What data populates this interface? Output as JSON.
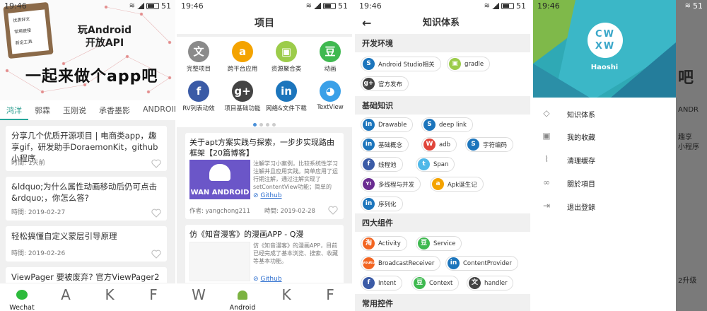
{
  "status": {
    "time": "19:46",
    "battery": "51"
  },
  "phone1": {
    "banner": {
      "clipboard_items": [
        "优质好文",
        "常用链接",
        "新定工具"
      ],
      "title_line1": "玩Android",
      "title_line2": "开放API",
      "slogan": "一起来做个app吧"
    },
    "tabs": [
      "鸿洋",
      "郭霖",
      "玉刚说",
      "承香墨影",
      "ANDROID"
    ],
    "articles": [
      {
        "title": "分享几个优质开源项目 | 电商类app，趣享gif，研发助手DoraemonKit，github小程序",
        "meta": "时間: 1天前"
      },
      {
        "title": "&ldquo;为什么属性动画移动后仍可点击&rdquo;，你怎么答?",
        "meta": "時間: 2019-02-27"
      },
      {
        "title": "轻松搞懂自定义蒙层引导原理",
        "meta": "時間: 2019-02-26"
      },
      {
        "title": "ViewPager 要被废弃? 官方ViewPager2升级",
        "meta": ""
      }
    ],
    "bottom_nav": [
      {
        "icon": "wechat-icon",
        "label": "Wechat"
      },
      {
        "icon": "A",
        "label": ""
      },
      {
        "icon": "K",
        "label": ""
      },
      {
        "icon": "F",
        "label": ""
      }
    ]
  },
  "phone2": {
    "title": "项目",
    "grid": [
      {
        "label": "完整项目",
        "glyph": "文",
        "color": "#8a8a8a"
      },
      {
        "label": "跨平台应用",
        "glyph": "a",
        "color": "#f4a300"
      },
      {
        "label": "资源聚合类",
        "glyph": "▣",
        "color": "#9ccc4a"
      },
      {
        "label": "动画",
        "glyph": "豆",
        "color": "#3fb950"
      },
      {
        "label": "RV列表动效",
        "glyph": "f",
        "color": "#3b5ba6"
      },
      {
        "label": "项目基础功能",
        "glyph": "g+",
        "color": "#444444"
      },
      {
        "label": "网络&文件下载",
        "glyph": "in",
        "color": "#1c75bc"
      },
      {
        "label": "TextView",
        "glyph": "◕",
        "color": "#3aa0e8"
      }
    ],
    "cards": [
      {
        "title": "关于apt方案实践与探索，一步步实现路由框架【20篇博客】",
        "thumb_text": "WAN ANDROID",
        "desc": "注解学习小案例，比较系统性学习注解并且应用实践。简单应用了运行期注解，通过注解实现了setContentView功能；简单的",
        "github": "Github",
        "author": "作者: yangchong211",
        "time": "時間: 2019-02-28"
      },
      {
        "title": "仿《知音漫客》的漫画APP - Q漫",
        "desc": "仿《知音漫客》的漫画APP，目前已经完成了基本浏览、搜索、收藏等基本功能。",
        "github": "Github"
      }
    ],
    "bottom_nav": [
      {
        "icon": "W",
        "label": ""
      },
      {
        "icon": "android-icon",
        "label": "Android"
      },
      {
        "icon": "K",
        "label": ""
      },
      {
        "icon": "F",
        "label": ""
      }
    ]
  },
  "phone3": {
    "title": "知识体系",
    "sections": [
      {
        "name": "开发环境",
        "chips": [
          {
            "label": "Android Studio相关",
            "glyph": "S",
            "color": "#1c75bc"
          },
          {
            "label": "gradle",
            "glyph": "▣",
            "color": "#9ccc4a"
          },
          {
            "label": "官方发布",
            "glyph": "g+",
            "color": "#444444"
          }
        ]
      },
      {
        "name": "基础知识",
        "chips": [
          {
            "label": "Drawable",
            "glyph": "in",
            "color": "#1c75bc"
          },
          {
            "label": "deep link",
            "glyph": "S",
            "color": "#1c75bc"
          },
          {
            "label": "基础概念",
            "glyph": "in",
            "color": "#1c75bc"
          },
          {
            "label": "adb",
            "glyph": "W",
            "color": "#e0453a"
          },
          {
            "label": "字符编码",
            "glyph": "S",
            "color": "#1c75bc"
          },
          {
            "label": "线程池",
            "glyph": "f",
            "color": "#3b5ba6"
          },
          {
            "label": "Span",
            "glyph": "t",
            "color": "#4fb8e8"
          },
          {
            "label": "多线程与并发",
            "glyph": "Y!",
            "color": "#6a2c91"
          },
          {
            "label": "Apk诞生记",
            "glyph": "a",
            "color": "#f4a300"
          },
          {
            "label": "序列化",
            "glyph": "in",
            "color": "#1c75bc"
          }
        ]
      },
      {
        "name": "四大组件",
        "chips": [
          {
            "label": "Activity",
            "glyph": "淘",
            "color": "#f26522"
          },
          {
            "label": "Service",
            "glyph": "豆",
            "color": "#3fb950"
          },
          {
            "label": "BroadcastReceiver",
            "glyph": "youku",
            "color": "#f26522"
          },
          {
            "label": "ContentProvider",
            "glyph": "in",
            "color": "#1c75bc"
          },
          {
            "label": "Intent",
            "glyph": "f",
            "color": "#3b5ba6"
          },
          {
            "label": "Context",
            "glyph": "豆",
            "color": "#3fb950"
          },
          {
            "label": "handler",
            "glyph": "文",
            "color": "#444444"
          }
        ]
      },
      {
        "name": "常用控件",
        "chips": []
      }
    ]
  },
  "phone4": {
    "avatar_text": "CWXW",
    "username": "Haoshi",
    "menu": [
      {
        "icon": "tag-icon",
        "label": "知识体系"
      },
      {
        "icon": "collect-icon",
        "label": "我的收藏"
      },
      {
        "icon": "broom-icon",
        "label": "清理缓存"
      },
      {
        "icon": "link-icon",
        "label": "關於項目"
      },
      {
        "icon": "logout-icon",
        "label": "退出登錄"
      }
    ]
  },
  "colors": {
    "accent": "#26a69a",
    "link": "#2e6fcf",
    "banner_teal": "#2fa9b5"
  }
}
